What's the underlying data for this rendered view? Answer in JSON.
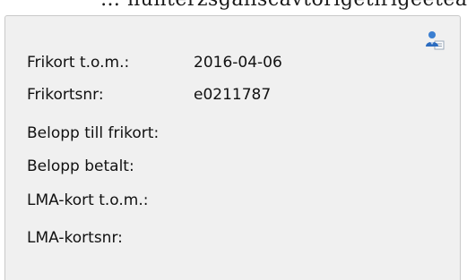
{
  "header": {
    "partial_text": "… hunterzsgaliscavtorigetirigeeteatuppgifter"
  },
  "panel": {
    "icon": "user-card-icon",
    "fields": [
      {
        "label": "Frikort t.o.m.:",
        "value": "2016-04-06"
      },
      {
        "label": "Frikortsnr:",
        "value": "e0211787"
      },
      {
        "label": "Belopp till frikort:",
        "value": ""
      },
      {
        "label": "Belopp betalt:",
        "value": ""
      },
      {
        "label": "LMA-kort t.o.m.:",
        "value": ""
      },
      {
        "label": "LMA-kortsnr:",
        "value": ""
      }
    ]
  }
}
